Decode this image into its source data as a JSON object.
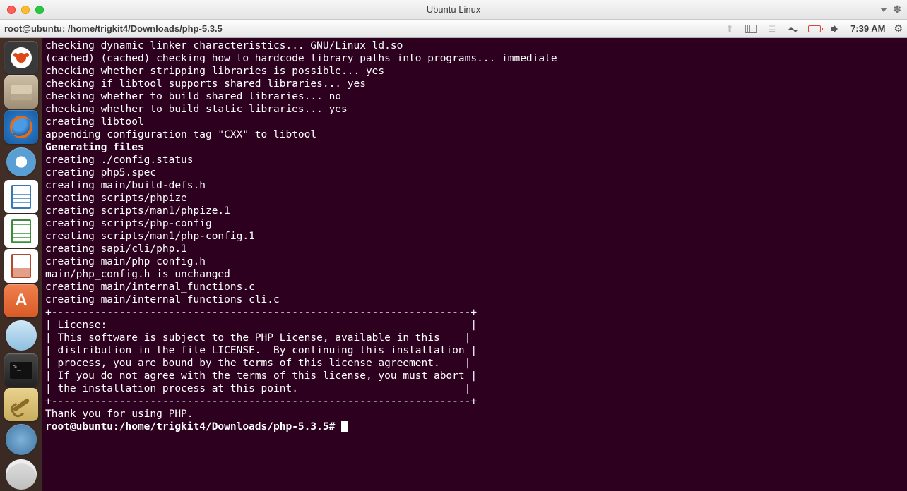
{
  "mac_title": "Ubuntu Linux",
  "panel": {
    "title": "root@ubuntu: /home/trigkit4/Downloads/php-5.3.5",
    "time": "7:39 AM"
  },
  "launcher": {
    "items": [
      {
        "name": "dash",
        "title": "Dash Home"
      },
      {
        "name": "files",
        "title": "Files"
      },
      {
        "name": "firefox",
        "title": "Firefox Web Browser"
      },
      {
        "name": "chromium",
        "title": "Chromium"
      },
      {
        "name": "writer",
        "title": "LibreOffice Writer"
      },
      {
        "name": "calc",
        "title": "LibreOffice Calc"
      },
      {
        "name": "impress",
        "title": "LibreOffice Impress"
      },
      {
        "name": "software",
        "title": "Ubuntu Software Center",
        "glyph": "A"
      },
      {
        "name": "updates",
        "title": "Software Updater"
      },
      {
        "name": "terminal",
        "title": "Terminal",
        "glyph": ">_"
      },
      {
        "name": "settings",
        "title": "System Settings"
      },
      {
        "name": "about",
        "title": "About"
      },
      {
        "name": "disks",
        "title": "Disks"
      }
    ]
  },
  "terminal": {
    "lines_pre": [
      "checking dynamic linker characteristics... GNU/Linux ld.so",
      "(cached) (cached) checking how to hardcode library paths into programs... immediate",
      "checking whether stripping libraries is possible... yes",
      "checking if libtool supports shared libraries... yes",
      "checking whether to build shared libraries... no",
      "checking whether to build static libraries... yes",
      "",
      "creating libtool",
      "appending configuration tag \"CXX\" to libtool",
      ""
    ],
    "heading": "Generating files",
    "lines_post": [
      "creating ./config.status",
      "creating php5.spec",
      "creating main/build-defs.h",
      "creating scripts/phpize",
      "creating scripts/man1/phpize.1",
      "creating scripts/php-config",
      "creating scripts/man1/php-config.1",
      "creating sapi/cli/php.1",
      "creating main/php_config.h",
      "main/php_config.h is unchanged",
      "creating main/internal_functions.c",
      "creating main/internal_functions_cli.c",
      "+--------------------------------------------------------------------+",
      "| License:                                                           |",
      "| This software is subject to the PHP License, available in this    |",
      "| distribution in the file LICENSE.  By continuing this installation |",
      "| process, you are bound by the terms of this license agreement.    |",
      "| If you do not agree with the terms of this license, you must abort |",
      "| the installation process at this point.                           |",
      "+--------------------------------------------------------------------+",
      "",
      "Thank you for using PHP.",
      ""
    ],
    "prompt_bold": "root@ubuntu:/home/trigkit4/Downloads/php-5.3.5#",
    "prompt_tail": " "
  }
}
